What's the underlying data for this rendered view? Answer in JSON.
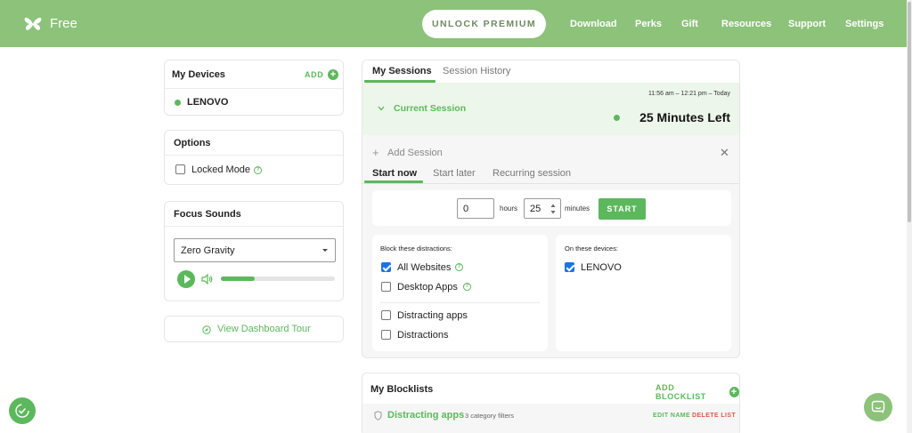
{
  "header": {
    "brand": "Free",
    "unlock_label": "UNLOCK PREMIUM",
    "nav": [
      "Download",
      "Perks",
      "Gift",
      "Resources",
      "Support",
      "Settings"
    ]
  },
  "devices": {
    "title": "My Devices",
    "add_label": "ADD",
    "items": [
      {
        "name": "LENOVO"
      }
    ]
  },
  "options": {
    "title": "Options",
    "locked_mode_label": "Locked Mode",
    "locked_mode_checked": false
  },
  "focus_sounds": {
    "title": "Focus Sounds",
    "selected": "Zero Gravity",
    "volume": 0.3
  },
  "tour": {
    "label": "View Dashboard Tour"
  },
  "sessions": {
    "tabs": [
      "My Sessions",
      "Session History"
    ],
    "active_tab": "My Sessions",
    "current": {
      "label": "Current Session",
      "time_range": "11:56 am – 12:21 pm – Today",
      "remaining": "25 Minutes Left"
    },
    "add": {
      "label": "Add Session",
      "tabs": [
        "Start now",
        "Start later",
        "Recurring session"
      ],
      "active_tab": "Start now",
      "hours_value": "0",
      "hours_label": "hours",
      "minutes_value": "25",
      "minutes_label": "minutes",
      "start_label": "START"
    },
    "block": {
      "title": "Block these distractions:",
      "items": [
        {
          "label": "All Websites",
          "checked": true,
          "info": true
        },
        {
          "label": "Desktop Apps",
          "checked": false,
          "info": true
        },
        {
          "label": "Distracting apps",
          "checked": false,
          "info": false
        },
        {
          "label": "Distractions",
          "checked": false,
          "info": false
        }
      ]
    },
    "devices": {
      "title": "On these devices:",
      "items": [
        {
          "label": "LENOVO",
          "checked": true
        }
      ]
    }
  },
  "blocklists": {
    "title": "My Blocklists",
    "add_label": "ADD BLOCKLIST",
    "items": [
      {
        "name": "Distracting apps",
        "meta": "3 category filters",
        "edit_label": "EDIT NAME",
        "delete_label": "DELETE LIST"
      }
    ]
  },
  "colors": {
    "header_bg": "#8cc27a",
    "accent": "#5cb85c",
    "danger": "#e05a4f",
    "checkbox_blue": "#1a73e8"
  }
}
